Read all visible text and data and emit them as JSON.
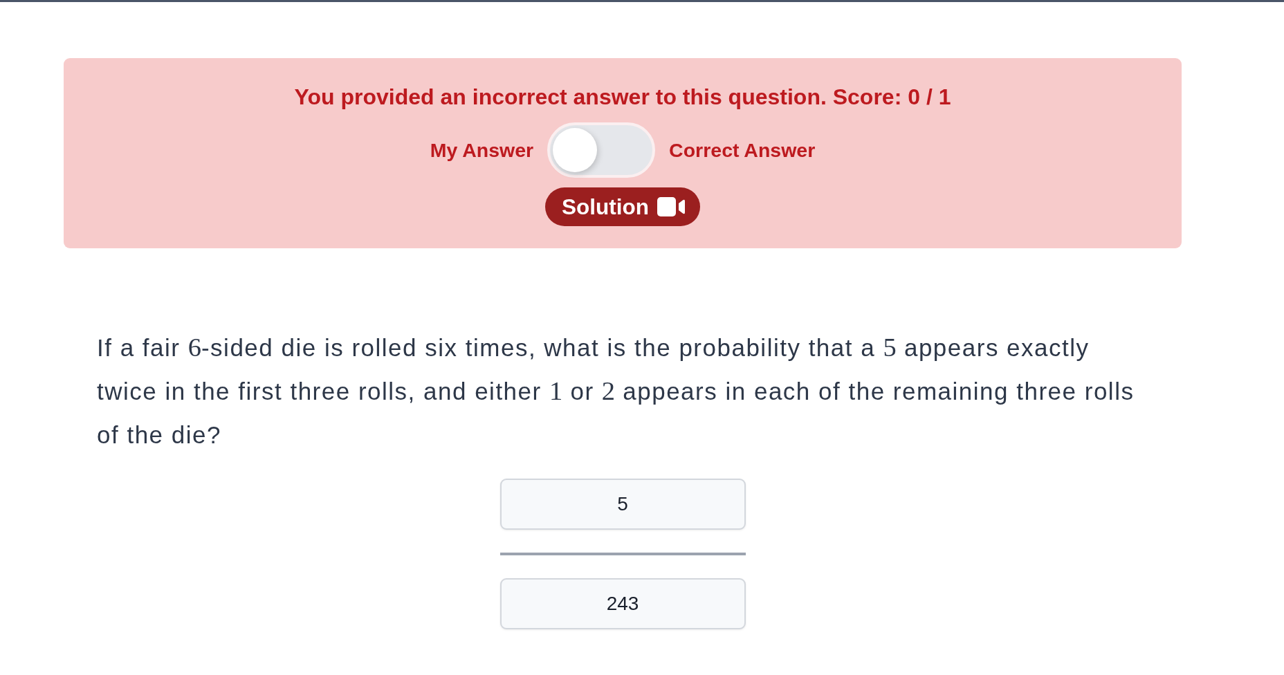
{
  "feedback": {
    "message": "You provided an incorrect answer to this question. Score: 0 / 1",
    "toggle": {
      "left_label": "My Answer",
      "right_label": "Correct Answer",
      "on": false
    },
    "solution_button": {
      "label": "Solution"
    }
  },
  "question": {
    "parts": [
      {
        "kind": "text",
        "text": "If a fair "
      },
      {
        "kind": "math",
        "text": "6"
      },
      {
        "kind": "text",
        "text": "-sided die is rolled six times, what is the probability that a "
      },
      {
        "kind": "math",
        "text": "5"
      },
      {
        "kind": "text",
        "text": " appears exactly twice in the first three rolls, and either "
      },
      {
        "kind": "math",
        "text": "1"
      },
      {
        "kind": "text",
        "text": " or "
      },
      {
        "kind": "math",
        "text": "2"
      },
      {
        "kind": "text",
        "text": " appears in each of the remaining three rolls of the die?"
      }
    ]
  },
  "answer": {
    "numerator": "5",
    "denominator": "243"
  }
}
